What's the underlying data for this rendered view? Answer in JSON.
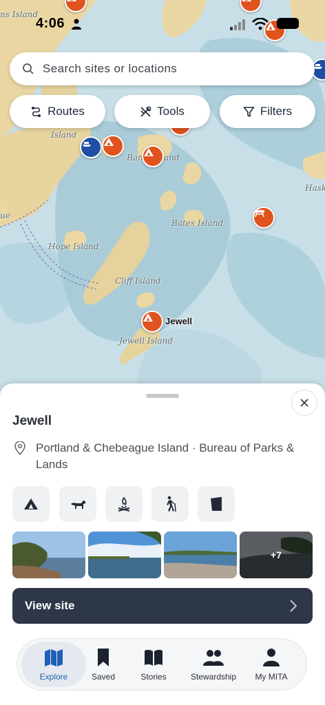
{
  "status_bar": {
    "time": "4:06"
  },
  "search": {
    "placeholder": "Search sites or locations"
  },
  "chips": [
    {
      "label": "Routes",
      "icon": "routes-icon"
    },
    {
      "label": "Tools",
      "icon": "tools-icon"
    },
    {
      "label": "Filters",
      "icon": "filter-icon"
    }
  ],
  "map": {
    "labels": [
      "ns Island",
      "Island",
      "Ban",
      "and",
      "Bates Island",
      "Hope Island",
      "Cliff Island",
      "Jewell Island",
      "Hask",
      "ue"
    ],
    "selected_pin_label": "Jewell"
  },
  "site": {
    "title": "Jewell",
    "location": "Portland & Chebeague Island · Bureau of Parks & Lands",
    "amenities": [
      "tent-icon",
      "dog-icon",
      "campfire-icon",
      "hiking-icon",
      "privy-icon"
    ],
    "photos_more": "+7",
    "view_button": "View site"
  },
  "tabs": [
    {
      "label": "Explore",
      "active": true
    },
    {
      "label": "Saved"
    },
    {
      "label": "Stories"
    },
    {
      "label": "Stewardship"
    },
    {
      "label": "My MITA"
    }
  ],
  "colors": {
    "accent": "#e0531f",
    "ferry": "#1f4fa5",
    "button": "#2e3748",
    "active_tab": "#1f5fb6"
  }
}
